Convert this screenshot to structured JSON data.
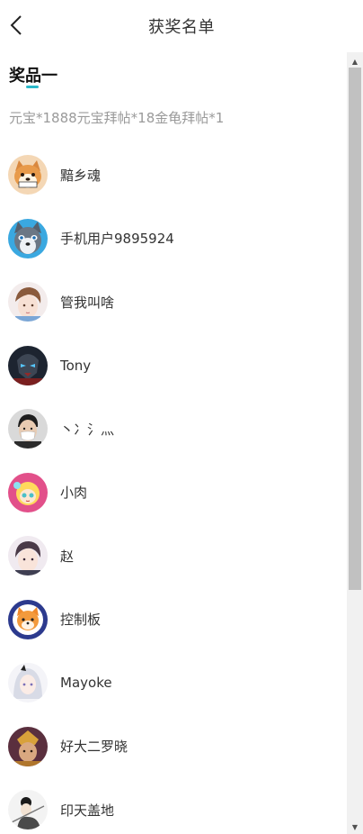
{
  "header": {
    "title": "获奖名单",
    "back_icon": "chevron-left-icon"
  },
  "prize": {
    "tab_label": "奖品一",
    "description": "元宝*1888元宝拜帖*18金龟拜帖*1",
    "accent_color": "#2bb8c9"
  },
  "winners": [
    {
      "name": "黯乡魂",
      "avatar": "shiba-dog-avatar"
    },
    {
      "name": "手机用户9895924",
      "avatar": "husky-dog-avatar"
    },
    {
      "name": "管我叫啥",
      "avatar": "anime-boy-avatar"
    },
    {
      "name": "Tony",
      "avatar": "armored-hero-avatar"
    },
    {
      "name": "丶冫氵灬",
      "avatar": "masked-man-avatar"
    },
    {
      "name": "小肉",
      "avatar": "cartoon-girl-avatar"
    },
    {
      "name": "赵",
      "avatar": "anime-boy-avatar"
    },
    {
      "name": "控制板",
      "avatar": "fox-avatar"
    },
    {
      "name": "Mayoke",
      "avatar": "anime-girl-avatar"
    },
    {
      "name": "好大二罗晓",
      "avatar": "warrior-avatar"
    },
    {
      "name": "印天盖地",
      "avatar": "ink-warrior-avatar"
    }
  ],
  "scrollbar": {
    "up_glyph": "▲",
    "down_glyph": "▼"
  }
}
